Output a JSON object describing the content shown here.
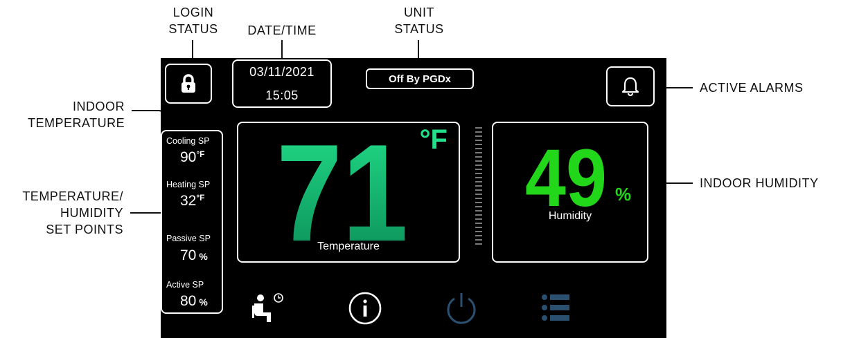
{
  "callouts": {
    "login_status": [
      "LOGIN",
      "STATUS"
    ],
    "date_time": "DATE/TIME",
    "unit_status": [
      "UNIT",
      "STATUS"
    ],
    "indoor_temperature": [
      "INDOOR",
      "TEMPERATURE"
    ],
    "set_points": [
      "TEMPERATURE/",
      "HUMIDITY",
      "SET POINTS"
    ],
    "active_alarms": "ACTIVE ALARMS",
    "indoor_humidity": "INDOOR HUMIDITY"
  },
  "header": {
    "date": "03/11/2021",
    "time": "15:05",
    "unit_status": "Off By PGDx"
  },
  "setpoints": [
    {
      "label": "Cooling SP",
      "value": "90",
      "unit": "°F"
    },
    {
      "label": "Heating SP",
      "value": "32",
      "unit": "°F"
    },
    {
      "label": "Passive SP",
      "value": "70",
      "unit": "%"
    },
    {
      "label": "Active SP",
      "value": "80",
      "unit": "%"
    }
  ],
  "temperature": {
    "value": "71",
    "unit": "°F",
    "label": "Temperature"
  },
  "humidity": {
    "value": "49",
    "unit": "%",
    "label": "Humidity"
  },
  "nav_icons": [
    "occupancy-schedule-icon",
    "info-icon",
    "power-icon",
    "menu-list-icon"
  ],
  "colors": {
    "background": "#000000",
    "temperature_top": "#22e08a",
    "temperature_bottom": "#0a8a55",
    "humidity": "#22d61a",
    "power_icon": "#2b4f6e",
    "menu_icon": "#2b4f6e"
  },
  "icons": {
    "login": "lock-icon",
    "alarms": "bell-icon"
  }
}
